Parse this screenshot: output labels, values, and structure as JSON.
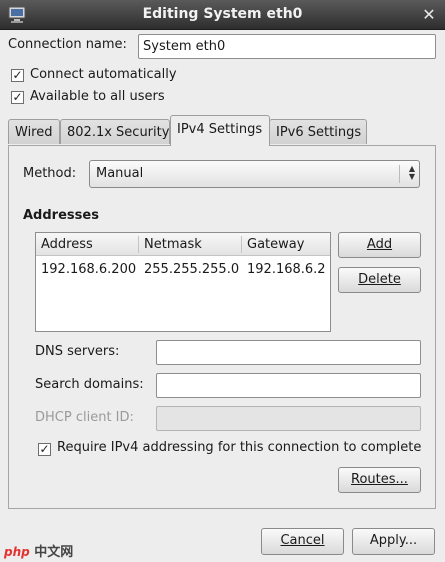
{
  "window": {
    "title": "Editing System eth0",
    "close_glyph": "✕"
  },
  "connection": {
    "name_label": "Connection name:",
    "name_value": "System eth0"
  },
  "options": {
    "connect_auto": {
      "label": "Connect automatically",
      "checked": true
    },
    "all_users": {
      "label": "Available to all users",
      "checked": true
    }
  },
  "tabs": [
    "Wired",
    "802.1x Security",
    "IPv4 Settings",
    "IPv6 Settings"
  ],
  "active_tab": "IPv4 Settings",
  "ipv4": {
    "method_label": "Method:",
    "method_value": "Manual",
    "addresses_heading": "Addresses",
    "columns": [
      "Address",
      "Netmask",
      "Gateway"
    ],
    "rows": [
      {
        "address": "192.168.6.200",
        "netmask": "255.255.255.0",
        "gateway": "192.168.6.2"
      }
    ],
    "add_label": "Add",
    "delete_label": "Delete",
    "dns_label": "DNS servers:",
    "dns_value": "",
    "search_label": "Search domains:",
    "search_value": "",
    "dhcp_label": "DHCP client ID:",
    "dhcp_value": "",
    "require_label": "Require IPv4 addressing for this connection to complete",
    "require_checked": true,
    "routes_label": "Routes..."
  },
  "footer": {
    "cancel_label": "Cancel",
    "apply_label": "Apply..."
  },
  "watermark": {
    "brand": "php",
    "suffix": "中文网"
  },
  "icons": {
    "window": "network-computer-icon",
    "close": "close-icon",
    "check": "check-icon",
    "combo": "up-down-arrows-icon"
  },
  "colors": {
    "titlebar": "#3a3a3a",
    "panel": "#ededed",
    "watermark": "#e3322f"
  }
}
